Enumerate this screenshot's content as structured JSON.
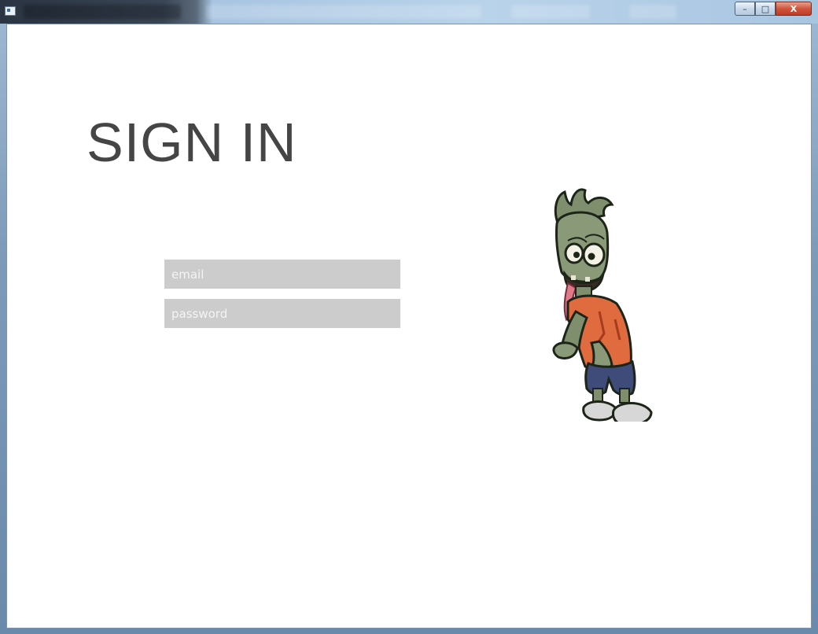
{
  "window": {
    "title_buttons": {
      "minimize": "–",
      "maximize": "□",
      "close": "X"
    }
  },
  "form": {
    "heading": "SIGN IN",
    "email_placeholder": "email",
    "password_placeholder": "password"
  },
  "illustration": {
    "name": "zombie-character"
  }
}
